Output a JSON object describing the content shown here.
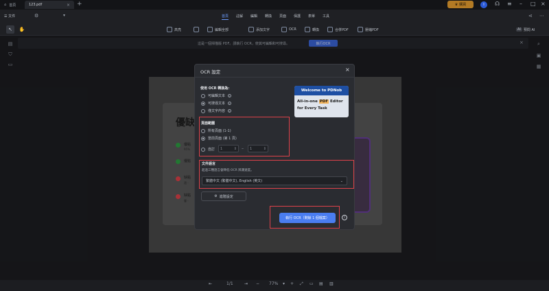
{
  "titlebar": {
    "home_tab": "首頁",
    "doc_tab": "123.pdf",
    "upgrade_label": "購買",
    "avatar_letter": "I"
  },
  "menubar": {
    "file_label": "文件",
    "items": [
      "首頁",
      "註解",
      "編輯",
      "轉換",
      "頁面",
      "保護",
      "表單",
      "工具"
    ],
    "active": "首頁"
  },
  "toolbar": {
    "items": [
      "高亮",
      "",
      "編輯全部",
      "添加文字",
      "OCR",
      "轉換",
      "合併PDF",
      "壓縮PDF"
    ],
    "ai_label": "預問 AI",
    "ai_badge": "AI"
  },
  "notice": {
    "text": "這是一個掃描版 PDF。請執行 OCR，使其可編輯和可搜尋。",
    "button": "執行OCR"
  },
  "slide": {
    "title": "優缺",
    "bullets": [
      {
        "label": "優點",
        "sub": "95%",
        "color": "#2ea043"
      },
      {
        "label": "優點",
        "sub": "",
        "color": "#2ea043"
      },
      {
        "label": "缺點",
        "sub": "適 -",
        "color": "#e0424a"
      },
      {
        "label": "缺點",
        "sub": "豐 -",
        "color": "#e0424a"
      }
    ]
  },
  "modal": {
    "title": "OCR 設定",
    "convert_label": "使用 OCR 轉換為:",
    "convert_options": [
      {
        "label": "可編輯文本",
        "selected": false
      },
      {
        "label": "可搜尋文本",
        "selected": true
      },
      {
        "label": "僅文字內容",
        "selected": false
      }
    ],
    "range_label": "頁面範圍",
    "range_options": [
      {
        "label": "所有頁面 (1-1)",
        "selected": false
      },
      {
        "label": "當前頁面 (第 1 頁)",
        "selected": true
      },
      {
        "label": "自訂",
        "selected": false
      }
    ],
    "custom_from": "1",
    "custom_to": "1",
    "range_sep": "–",
    "lang_label": "文件語言",
    "lang_hint": "超過三種語言會降低 OCR 辨識速度。",
    "lang_value": "繁體中文 (繁體中文), English (英文)",
    "advanced_label": "進階設定",
    "run_label": "執行 OCR（剩餘 1 個檔案）",
    "promo_head": "Welcome to PDNob",
    "promo_line1_pre": "All-in-one ",
    "promo_line1_hl": "PDF",
    "promo_line1_post": " Editor",
    "promo_line2": "for Every Task"
  },
  "bottombar": {
    "page_indicator": "1/1",
    "zoom": "77%"
  },
  "colors": {
    "accent": "#4a7df0",
    "highlight_box": "#e0424a",
    "upgrade": "#b27a24"
  }
}
